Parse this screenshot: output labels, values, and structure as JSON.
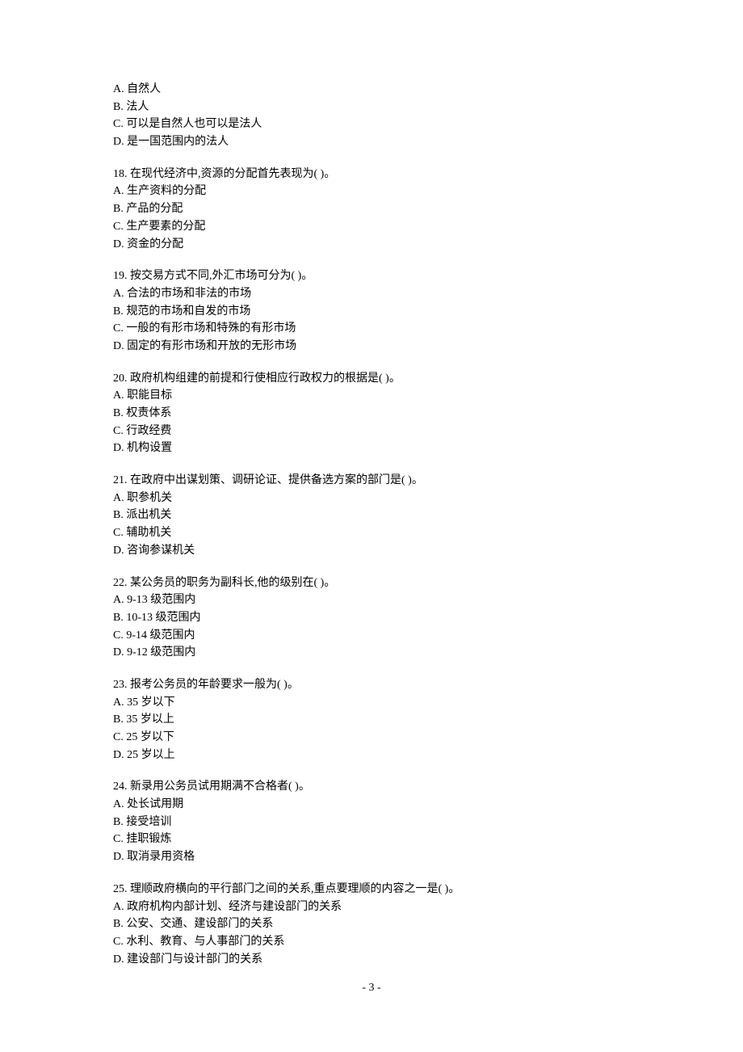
{
  "questions": [
    {
      "prompt": "",
      "options": [
        {
          "label": "A.",
          "text": "自然人"
        },
        {
          "label": "B.",
          "text": "法人"
        },
        {
          "label": "C.",
          "text": "可以是自然人也可以是法人"
        },
        {
          "label": "D.",
          "text": "是一国范围内的法人"
        }
      ]
    },
    {
      "prompt": "18. 在现代经济中,资源的分配首先表现为( )。",
      "options": [
        {
          "label": "A.",
          "text": "生产资料的分配"
        },
        {
          "label": "B.",
          "text": "产品的分配"
        },
        {
          "label": "C.",
          "text": "生产要素的分配"
        },
        {
          "label": "D.",
          "text": "资金的分配"
        }
      ]
    },
    {
      "prompt": "19. 按交易方式不同,外汇市场可分为( )。",
      "options": [
        {
          "label": "A.",
          "text": "合法的市场和非法的市场"
        },
        {
          "label": "B.",
          "text": "规范的市场和自发的市场"
        },
        {
          "label": "C.",
          "text": "一般的有形市场和特殊的有形市场"
        },
        {
          "label": "D.",
          "text": "固定的有形市场和开放的无形市场"
        }
      ]
    },
    {
      "prompt": "20. 政府机构组建的前提和行使相应行政权力的根据是( )。",
      "options": [
        {
          "label": "A.",
          "text": "职能目标"
        },
        {
          "label": "B.",
          "text": "权责体系"
        },
        {
          "label": "C.",
          "text": "行政经费"
        },
        {
          "label": "D.",
          "text": "机构设置"
        }
      ]
    },
    {
      "prompt": "21. 在政府中出谋划策、调研论证、提供备选方案的部门是( )。",
      "options": [
        {
          "label": "A.",
          "text": "职参机关"
        },
        {
          "label": "B.",
          "text": "派出机关"
        },
        {
          "label": "C.",
          "text": "辅助机关"
        },
        {
          "label": "D.",
          "text": "咨询参谋机关"
        }
      ]
    },
    {
      "prompt": "22. 某公务员的职务为副科长,他的级别在( )。",
      "options": [
        {
          "label": "A.",
          "text": "9-13 级范围内"
        },
        {
          "label": "B.",
          "text": "10-13 级范围内"
        },
        {
          "label": "C.",
          "text": "9-14 级范围内"
        },
        {
          "label": "D.",
          "text": "9-12 级范围内"
        }
      ]
    },
    {
      "prompt": "23. 报考公务员的年龄要求一般为( )。",
      "options": [
        {
          "label": "A.",
          "text": "35 岁以下"
        },
        {
          "label": "B.",
          "text": "35 岁以上"
        },
        {
          "label": "C.",
          "text": "25 岁以下"
        },
        {
          "label": "D.",
          "text": "25 岁以上"
        }
      ]
    },
    {
      "prompt": "24. 新录用公务员试用期满不合格者( )。",
      "options": [
        {
          "label": "A.",
          "text": "处长试用期"
        },
        {
          "label": "B.",
          "text": "接受培训"
        },
        {
          "label": "C.",
          "text": "挂职锻炼"
        },
        {
          "label": "D.",
          "text": "取消录用资格"
        }
      ]
    },
    {
      "prompt": "25. 理顺政府横向的平行部门之间的关系,重点要理顺的内容之一是( )。",
      "options": [
        {
          "label": "A.",
          "text": "政府机构内部计划、经济与建设部门的关系"
        },
        {
          "label": "B.",
          "text": "公安、交通、建设部门的关系"
        },
        {
          "label": "C.",
          "text": "水利、教育、与人事部门的关系"
        },
        {
          "label": "D.",
          "text": "建设部门与设计部门的关系"
        }
      ]
    }
  ],
  "page_number": "- 3 -"
}
